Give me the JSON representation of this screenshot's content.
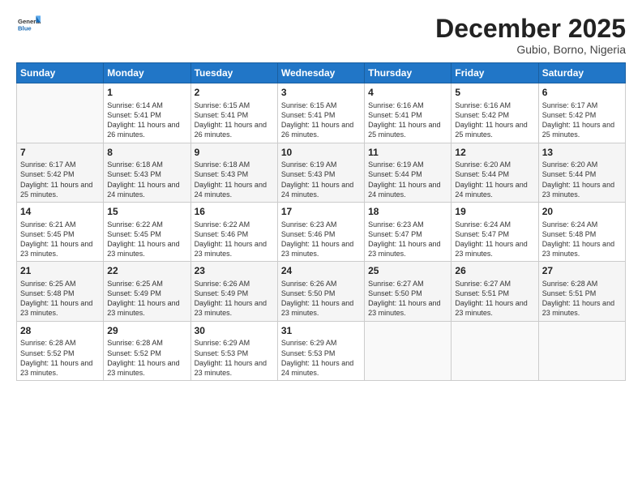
{
  "logo": {
    "general": "General",
    "blue": "Blue"
  },
  "header": {
    "month": "December 2025",
    "location": "Gubio, Borno, Nigeria"
  },
  "weekdays": [
    "Sunday",
    "Monday",
    "Tuesday",
    "Wednesday",
    "Thursday",
    "Friday",
    "Saturday"
  ],
  "weeks": [
    [
      {
        "day": "",
        "sunrise": "",
        "sunset": "",
        "daylight": ""
      },
      {
        "day": "1",
        "sunrise": "Sunrise: 6:14 AM",
        "sunset": "Sunset: 5:41 PM",
        "daylight": "Daylight: 11 hours and 26 minutes."
      },
      {
        "day": "2",
        "sunrise": "Sunrise: 6:15 AM",
        "sunset": "Sunset: 5:41 PM",
        "daylight": "Daylight: 11 hours and 26 minutes."
      },
      {
        "day": "3",
        "sunrise": "Sunrise: 6:15 AM",
        "sunset": "Sunset: 5:41 PM",
        "daylight": "Daylight: 11 hours and 26 minutes."
      },
      {
        "day": "4",
        "sunrise": "Sunrise: 6:16 AM",
        "sunset": "Sunset: 5:41 PM",
        "daylight": "Daylight: 11 hours and 25 minutes."
      },
      {
        "day": "5",
        "sunrise": "Sunrise: 6:16 AM",
        "sunset": "Sunset: 5:42 PM",
        "daylight": "Daylight: 11 hours and 25 minutes."
      },
      {
        "day": "6",
        "sunrise": "Sunrise: 6:17 AM",
        "sunset": "Sunset: 5:42 PM",
        "daylight": "Daylight: 11 hours and 25 minutes."
      }
    ],
    [
      {
        "day": "7",
        "sunrise": "Sunrise: 6:17 AM",
        "sunset": "Sunset: 5:42 PM",
        "daylight": "Daylight: 11 hours and 25 minutes."
      },
      {
        "day": "8",
        "sunrise": "Sunrise: 6:18 AM",
        "sunset": "Sunset: 5:43 PM",
        "daylight": "Daylight: 11 hours and 24 minutes."
      },
      {
        "day": "9",
        "sunrise": "Sunrise: 6:18 AM",
        "sunset": "Sunset: 5:43 PM",
        "daylight": "Daylight: 11 hours and 24 minutes."
      },
      {
        "day": "10",
        "sunrise": "Sunrise: 6:19 AM",
        "sunset": "Sunset: 5:43 PM",
        "daylight": "Daylight: 11 hours and 24 minutes."
      },
      {
        "day": "11",
        "sunrise": "Sunrise: 6:19 AM",
        "sunset": "Sunset: 5:44 PM",
        "daylight": "Daylight: 11 hours and 24 minutes."
      },
      {
        "day": "12",
        "sunrise": "Sunrise: 6:20 AM",
        "sunset": "Sunset: 5:44 PM",
        "daylight": "Daylight: 11 hours and 24 minutes."
      },
      {
        "day": "13",
        "sunrise": "Sunrise: 6:20 AM",
        "sunset": "Sunset: 5:44 PM",
        "daylight": "Daylight: 11 hours and 23 minutes."
      }
    ],
    [
      {
        "day": "14",
        "sunrise": "Sunrise: 6:21 AM",
        "sunset": "Sunset: 5:45 PM",
        "daylight": "Daylight: 11 hours and 23 minutes."
      },
      {
        "day": "15",
        "sunrise": "Sunrise: 6:22 AM",
        "sunset": "Sunset: 5:45 PM",
        "daylight": "Daylight: 11 hours and 23 minutes."
      },
      {
        "day": "16",
        "sunrise": "Sunrise: 6:22 AM",
        "sunset": "Sunset: 5:46 PM",
        "daylight": "Daylight: 11 hours and 23 minutes."
      },
      {
        "day": "17",
        "sunrise": "Sunrise: 6:23 AM",
        "sunset": "Sunset: 5:46 PM",
        "daylight": "Daylight: 11 hours and 23 minutes."
      },
      {
        "day": "18",
        "sunrise": "Sunrise: 6:23 AM",
        "sunset": "Sunset: 5:47 PM",
        "daylight": "Daylight: 11 hours and 23 minutes."
      },
      {
        "day": "19",
        "sunrise": "Sunrise: 6:24 AM",
        "sunset": "Sunset: 5:47 PM",
        "daylight": "Daylight: 11 hours and 23 minutes."
      },
      {
        "day": "20",
        "sunrise": "Sunrise: 6:24 AM",
        "sunset": "Sunset: 5:48 PM",
        "daylight": "Daylight: 11 hours and 23 minutes."
      }
    ],
    [
      {
        "day": "21",
        "sunrise": "Sunrise: 6:25 AM",
        "sunset": "Sunset: 5:48 PM",
        "daylight": "Daylight: 11 hours and 23 minutes."
      },
      {
        "day": "22",
        "sunrise": "Sunrise: 6:25 AM",
        "sunset": "Sunset: 5:49 PM",
        "daylight": "Daylight: 11 hours and 23 minutes."
      },
      {
        "day": "23",
        "sunrise": "Sunrise: 6:26 AM",
        "sunset": "Sunset: 5:49 PM",
        "daylight": "Daylight: 11 hours and 23 minutes."
      },
      {
        "day": "24",
        "sunrise": "Sunrise: 6:26 AM",
        "sunset": "Sunset: 5:50 PM",
        "daylight": "Daylight: 11 hours and 23 minutes."
      },
      {
        "day": "25",
        "sunrise": "Sunrise: 6:27 AM",
        "sunset": "Sunset: 5:50 PM",
        "daylight": "Daylight: 11 hours and 23 minutes."
      },
      {
        "day": "26",
        "sunrise": "Sunrise: 6:27 AM",
        "sunset": "Sunset: 5:51 PM",
        "daylight": "Daylight: 11 hours and 23 minutes."
      },
      {
        "day": "27",
        "sunrise": "Sunrise: 6:28 AM",
        "sunset": "Sunset: 5:51 PM",
        "daylight": "Daylight: 11 hours and 23 minutes."
      }
    ],
    [
      {
        "day": "28",
        "sunrise": "Sunrise: 6:28 AM",
        "sunset": "Sunset: 5:52 PM",
        "daylight": "Daylight: 11 hours and 23 minutes."
      },
      {
        "day": "29",
        "sunrise": "Sunrise: 6:28 AM",
        "sunset": "Sunset: 5:52 PM",
        "daylight": "Daylight: 11 hours and 23 minutes."
      },
      {
        "day": "30",
        "sunrise": "Sunrise: 6:29 AM",
        "sunset": "Sunset: 5:53 PM",
        "daylight": "Daylight: 11 hours and 23 minutes."
      },
      {
        "day": "31",
        "sunrise": "Sunrise: 6:29 AM",
        "sunset": "Sunset: 5:53 PM",
        "daylight": "Daylight: 11 hours and 24 minutes."
      },
      {
        "day": "",
        "sunrise": "",
        "sunset": "",
        "daylight": ""
      },
      {
        "day": "",
        "sunrise": "",
        "sunset": "",
        "daylight": ""
      },
      {
        "day": "",
        "sunrise": "",
        "sunset": "",
        "daylight": ""
      }
    ]
  ]
}
